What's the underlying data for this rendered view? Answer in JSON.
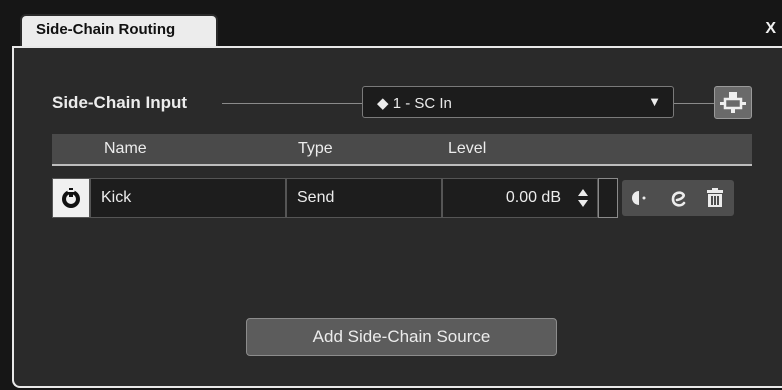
{
  "window": {
    "tab_title": "Side-Chain Routing",
    "close_label": "X"
  },
  "sidechain": {
    "input_label": "Side-Chain Input",
    "selected_input": "◆ 1 - SC In",
    "dropdown_arrow": "▼"
  },
  "table": {
    "columns": [
      "Name",
      "Type",
      "Level"
    ],
    "rows": [
      {
        "name": "Kick",
        "type": "Send",
        "level": "0.00 dB",
        "active": true
      }
    ]
  },
  "icons": {
    "routing": "routing-icon",
    "power": "power-icon",
    "spinner": "spinner-icon",
    "pan": "pan-icon",
    "edit": "edit-icon",
    "delete": "trash-icon"
  },
  "actions": {
    "add_source_label": "Add Side-Chain Source"
  }
}
